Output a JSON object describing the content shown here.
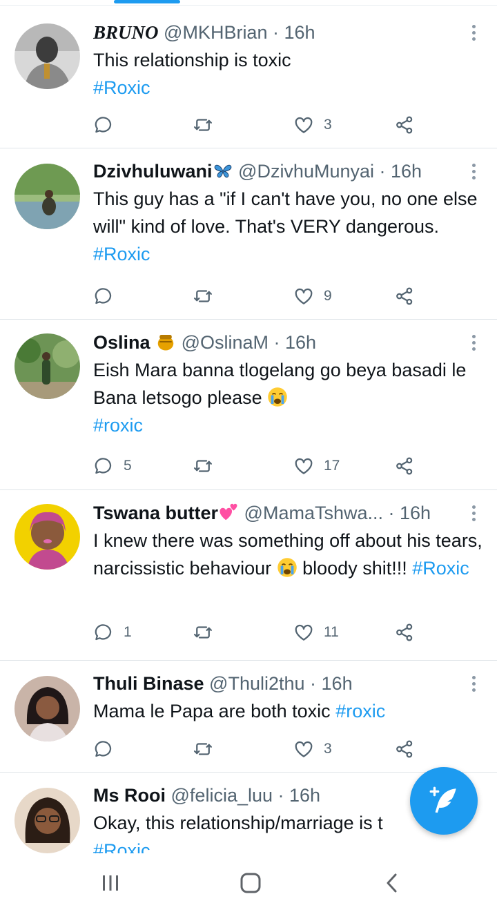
{
  "tweets": [
    {
      "name": "BRUNO",
      "handle": "@MKHBrian",
      "dot": " · ",
      "time": "16h",
      "text": "This relationship is toxic",
      "hashtag": "#Roxic",
      "replies": "",
      "likes": "3",
      "avatar_colors": [
        "#6b6b6b",
        "#cfcfcf"
      ]
    },
    {
      "name": "Dzivhuluwani",
      "handle": "@DzivhuMunyai",
      "dot": " · ",
      "time": "16h",
      "text": "This guy has a \"if I can't have you, no one else will\" kind of love. That's VERY dangerous. ",
      "hashtag": "#Roxic",
      "replies": "",
      "likes": "9",
      "avatar_colors": [
        "#5f8a4e",
        "#a8c48e"
      ]
    },
    {
      "name": "Oslina",
      "handle": "@OslinaM",
      "dot": " · ",
      "time": "16h",
      "text": "Eish Mara banna tlogelang go beya basadi le Bana letsogo please",
      "hashtag": "#roxic",
      "replies": "5",
      "likes": "17",
      "avatar_colors": [
        "#4d7a3a",
        "#8fb070"
      ]
    },
    {
      "name": "Tswana butter",
      "handle": "@MamaTshwa...",
      "dot": " · ",
      "time": "16h",
      "text": "I knew there was something off about his tears, narcissistic behaviour ",
      "text2": " bloody shit!!! ",
      "hashtag": "#Roxic",
      "replies": "1",
      "likes": "11",
      "avatar_colors": [
        "#e9c400",
        "#c64a92"
      ]
    },
    {
      "name": "Thuli Binase",
      "handle": "@Thuli2thu",
      "dot": " · ",
      "time": "16h",
      "text": "Mama le Papa are both toxic  ",
      "hashtag": "#roxic",
      "replies": "",
      "likes": "3",
      "avatar_colors": [
        "#3a2a2a",
        "#8a5a4a"
      ]
    },
    {
      "name": "Ms Rooi",
      "handle": "@felicia_luu",
      "dot": " · ",
      "time": "16h",
      "text": "Okay, this relationship/marriage is t",
      "hashtag": "#Roxic",
      "replies": "",
      "likes": "",
      "avatar_colors": [
        "#5a3a28",
        "#c7a07a"
      ]
    }
  ],
  "colors": {
    "accent": "#1d9bf0",
    "text": "#0f1419",
    "secondary": "#536471",
    "divider": "#dfe4e8"
  },
  "icons": {
    "reply": "reply-icon",
    "retweet": "retweet-icon",
    "like": "heart-icon",
    "share": "share-icon",
    "more": "more-vertical-icon",
    "compose": "compose-tweet-icon",
    "nav_recent": "recent-apps-icon",
    "nav_home": "home-icon",
    "nav_back": "back-icon"
  }
}
